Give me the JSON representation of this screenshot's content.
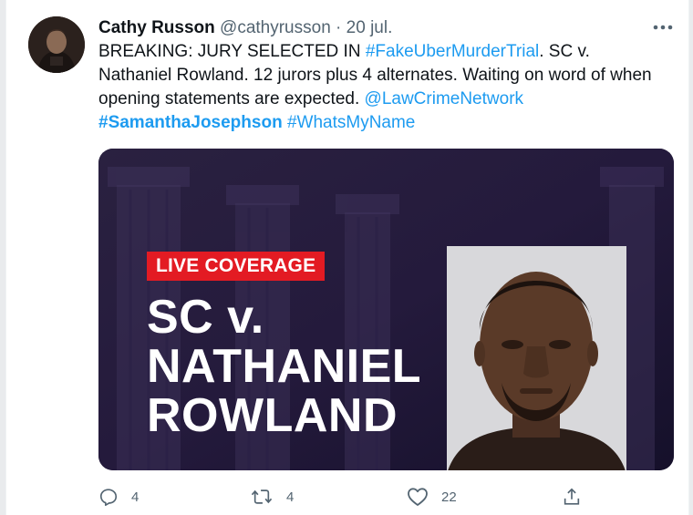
{
  "tweet": {
    "author_name": "Cathy Russon",
    "handle": "@cathyrusson",
    "separator": "·",
    "date": "20 jul.",
    "text_part1": "BREAKING: JURY SELECTED IN ",
    "hashtag_trial": "#FakeUberMurderTrial",
    "text_part2": ".  SC v. Nathaniel Rowland.  12 jurors plus 4 alternates. Waiting on word of when opening statements are expected. ",
    "mention": "@LawCrimeNetwork",
    "hashtag_victim": "#SamanthaJosephson",
    "hashtag_whatsmyname": "#WhatsMyName"
  },
  "media": {
    "badge": "LIVE COVERAGE",
    "title_line1": "SC v.",
    "title_line2": "NATHANIEL",
    "title_line3": "ROWLAND"
  },
  "actions": {
    "reply_count": "4",
    "retweet_count": "4",
    "like_count": "22"
  },
  "colors": {
    "link": "#1d9bf0",
    "badge_red": "#e31b23",
    "muted": "#536471"
  },
  "icons": [
    "more-icon",
    "reply-icon",
    "retweet-icon",
    "like-icon",
    "share-icon"
  ]
}
